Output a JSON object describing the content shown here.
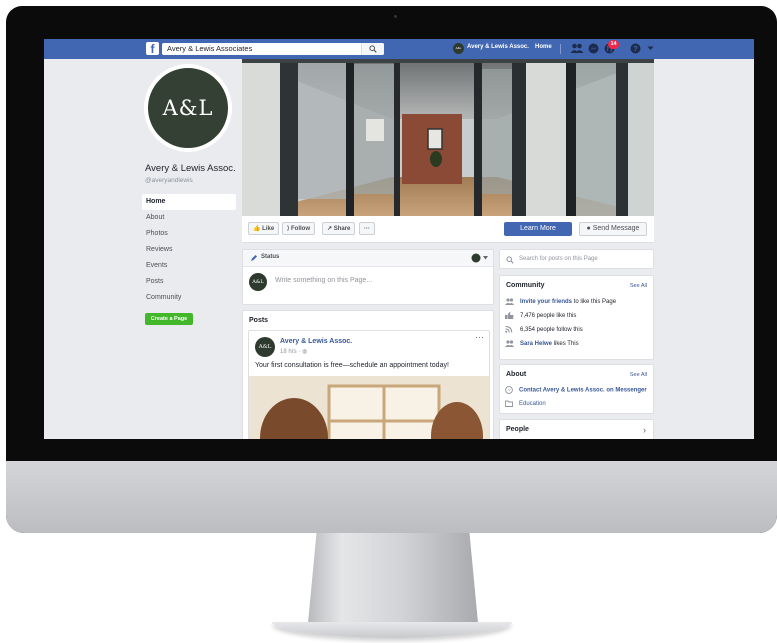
{
  "topbar": {
    "logo": "f",
    "search_value": "Avery & Lewis Associates",
    "profile_name": "Avery & Lewis Assoc.",
    "profile_avatar_text": "A&L",
    "home_label": "Home",
    "notification_count": "14",
    "brand_color": "#4267b2"
  },
  "profile": {
    "logo_text": "A&L",
    "name": "Avery & Lewis Assoc.",
    "handle": "@averyandlewis",
    "avatar_color": "#344033"
  },
  "sidebar": {
    "items": [
      {
        "label": "Home",
        "active": true
      },
      {
        "label": "About"
      },
      {
        "label": "Photos"
      },
      {
        "label": "Reviews"
      },
      {
        "label": "Events"
      },
      {
        "label": "Posts"
      },
      {
        "label": "Community"
      }
    ],
    "create_page_label": "Create a Page"
  },
  "actions": {
    "like": "Like",
    "follow": "Follow",
    "share": "Share",
    "more": "···",
    "learn_more": "Learn More",
    "send_message": "Send Message"
  },
  "status": {
    "label": "Status",
    "avatar_text": "A&L",
    "placeholder": "Write something on this Page..."
  },
  "posts": {
    "title": "Posts",
    "author": "Avery & Lewis Assoc.",
    "avatar_text": "A&L",
    "time": "18 hrs",
    "text": "Your first consultation is free—schedule an appointment today!",
    "more": "···"
  },
  "right": {
    "search_placeholder": "Search for posts on this Page",
    "community": {
      "title": "Community",
      "see_all": "See All",
      "invite_link": "Invite your friends",
      "invite_rest": "to like this Page",
      "likes": "7,476 people like this",
      "follows": "6,354 people follow this",
      "friend_name": "Sara Helwe",
      "friend_rest": "likes This"
    },
    "about": {
      "title": "About",
      "see_all": "See All",
      "contact": "Contact Avery & Lewis Assoc. on Messenger",
      "category": "Education"
    },
    "people": {
      "title": "People"
    }
  }
}
